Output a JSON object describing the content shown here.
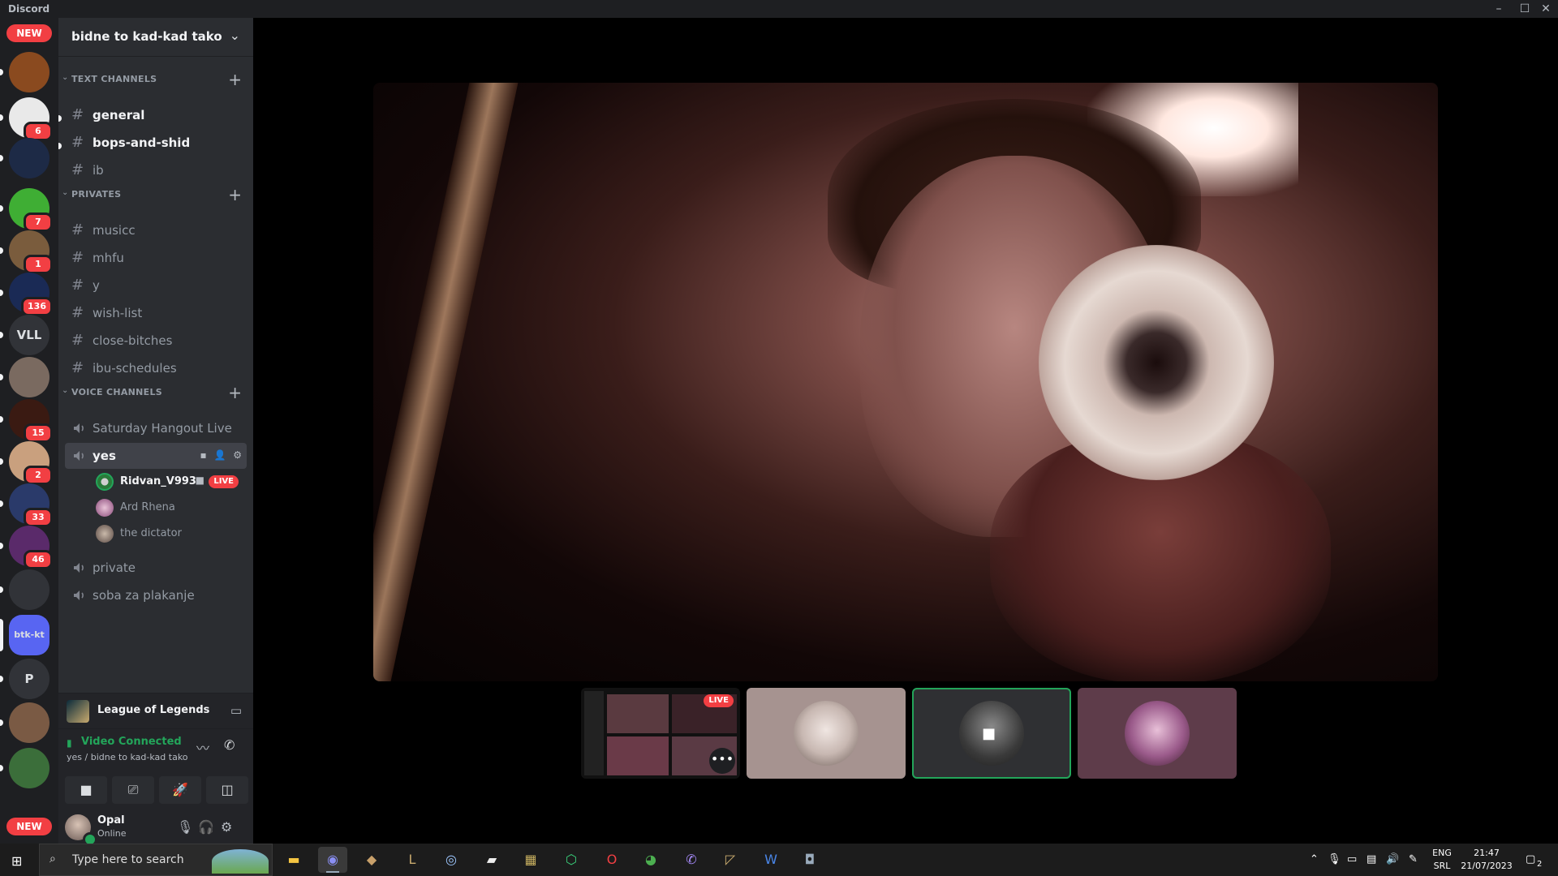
{
  "window": {
    "title": "Discord"
  },
  "rail": {
    "new_top": "NEW",
    "new_bottom": "NEW",
    "servers": [
      {
        "label": "",
        "badge": "",
        "color": "#8a4a1f"
      },
      {
        "label": "",
        "badge": "6",
        "color": "#e9e9e9"
      },
      {
        "label": "",
        "badge": "",
        "color": "#1d2a46"
      },
      {
        "label": "",
        "badge": "7",
        "color": "#3fae34"
      },
      {
        "label": "",
        "badge": "1",
        "color": "#7a5c3d"
      },
      {
        "label": "",
        "badge": "136",
        "color": "#1a2a55"
      },
      {
        "label": "VLL",
        "badge": "",
        "color": "#313338"
      },
      {
        "label": "",
        "badge": "",
        "color": "#7a6a60"
      },
      {
        "label": "",
        "badge": "15",
        "color": "#3a1a12"
      },
      {
        "label": "",
        "badge": "2",
        "color": "#c9a07e"
      },
      {
        "label": "",
        "badge": "33",
        "color": "#2a3a6a"
      },
      {
        "label": "",
        "badge": "46",
        "color": "#5a2a6a"
      },
      {
        "label": "",
        "badge": "",
        "color": "#313338"
      },
      {
        "label": "btk-kt",
        "badge": "",
        "color": "#5865f2"
      },
      {
        "label": "P",
        "badge": "",
        "color": "#313338"
      },
      {
        "label": "",
        "badge": "",
        "color": "#7a5a44"
      },
      {
        "label": "",
        "badge": "",
        "color": "#3b6e3a"
      }
    ]
  },
  "guild": {
    "name": "bidne to kad-kad tako"
  },
  "categories": {
    "text": "TEXT CHANNELS",
    "privates": "PRIVATES",
    "voice": "VOICE CHANNELS"
  },
  "text_channels": [
    "general",
    "bops-and-shid",
    "ib"
  ],
  "private_channels": [
    "musicc",
    "mhfu",
    "y",
    "wish-list",
    "close-bitches",
    "ibu-schedules"
  ],
  "voice_channels": [
    "Saturday Hangout Live",
    "yes",
    "private",
    "soba za plakanje"
  ],
  "voice_users": [
    {
      "name": "Ridvan_V993",
      "live": "LIVE"
    },
    {
      "name": "Ard Rhena"
    },
    {
      "name": "the dictator"
    }
  ],
  "activity": {
    "name": "League of Legends"
  },
  "rtc": {
    "status": "Video Connected",
    "location": "yes / bidne to kad-kad tako"
  },
  "user": {
    "name": "Opal",
    "status": "Online"
  },
  "stage": {
    "thumb_live": "LIVE",
    "more": "•••"
  },
  "taskbar": {
    "search_placeholder": "Type here to search",
    "lang_top": "ENG",
    "lang_bottom": "SRL",
    "time": "21:47",
    "date": "21/07/2023",
    "notif_count": "2"
  }
}
